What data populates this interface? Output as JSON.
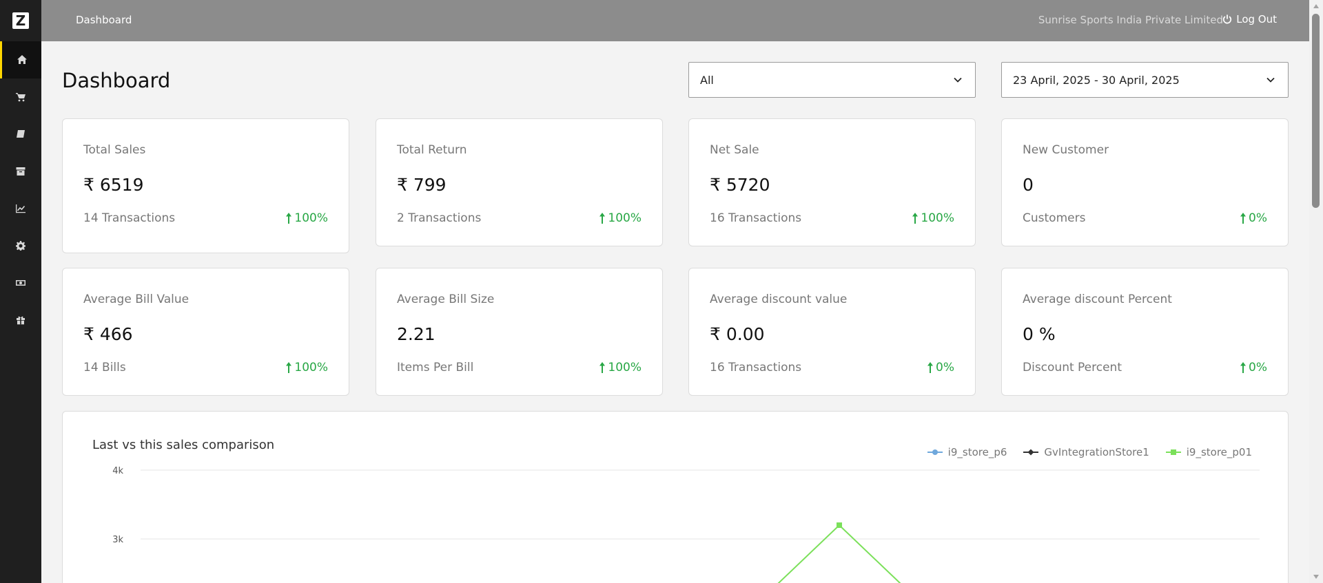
{
  "app": {
    "logo_letter": "Z"
  },
  "sidebar": {
    "items": [
      {
        "name": "home",
        "icon": "home-icon",
        "active": true
      },
      {
        "name": "cart",
        "icon": "cart-icon",
        "active": false
      },
      {
        "name": "book",
        "icon": "book-icon",
        "active": false
      },
      {
        "name": "archive",
        "icon": "archive-icon",
        "active": false
      },
      {
        "name": "analytics",
        "icon": "chart-line-icon",
        "active": false
      },
      {
        "name": "settings",
        "icon": "gear-icon",
        "active": false
      },
      {
        "name": "money",
        "icon": "money-icon",
        "active": false
      },
      {
        "name": "gift",
        "icon": "gift-icon",
        "active": false
      }
    ]
  },
  "topbar": {
    "breadcrumb": "Dashboard",
    "company": "Sunrise Sports India Private Limited",
    "logout_label": "Log Out"
  },
  "page": {
    "title": "Dashboard",
    "store_filter": "All",
    "date_filter": "23 April, 2025 - 30 April, 2025"
  },
  "cards": [
    {
      "title": "Total Sales",
      "value": "₹ 6519",
      "sub": "14 Transactions",
      "trend": "100%"
    },
    {
      "title": "Total Return",
      "value": "₹ 799",
      "sub": "2 Transactions",
      "trend": "100%"
    },
    {
      "title": "Net Sale",
      "value": "₹ 5720",
      "sub": "16 Transactions",
      "trend": "100%"
    },
    {
      "title": "New Customer",
      "value": "0",
      "sub": "Customers",
      "trend": "0%"
    },
    {
      "title": "Average Bill Value",
      "value": "₹ 466",
      "sub": "14 Bills",
      "trend": "100%"
    },
    {
      "title": "Average Bill Size",
      "value": "2.21",
      "sub": "Items Per Bill",
      "trend": "100%"
    },
    {
      "title": "Average discount value",
      "value": "₹ 0.00",
      "sub": "16 Transactions",
      "trend": "0%"
    },
    {
      "title": "Average discount Percent",
      "value": "0 %",
      "sub": "Discount Percent",
      "trend": "0%"
    }
  ],
  "colors": {
    "trend_up": "#28a745",
    "accent": "#ffd600",
    "series_p6": "#6fa8dc",
    "series_gv": "#333333",
    "series_p01": "#7be05a"
  },
  "chart_data": {
    "type": "line",
    "title": "Last vs this sales comparison",
    "y_ticks": [
      "4k",
      "3k"
    ],
    "ylim_visible": [
      2500,
      4000
    ],
    "series": [
      {
        "name": "i9_store_p6",
        "values": []
      },
      {
        "name": "GvIntegrationStore1",
        "values": []
      },
      {
        "name": "i9_store_p01",
        "peak_value": 3200
      }
    ],
    "legend_position": "top-right"
  }
}
